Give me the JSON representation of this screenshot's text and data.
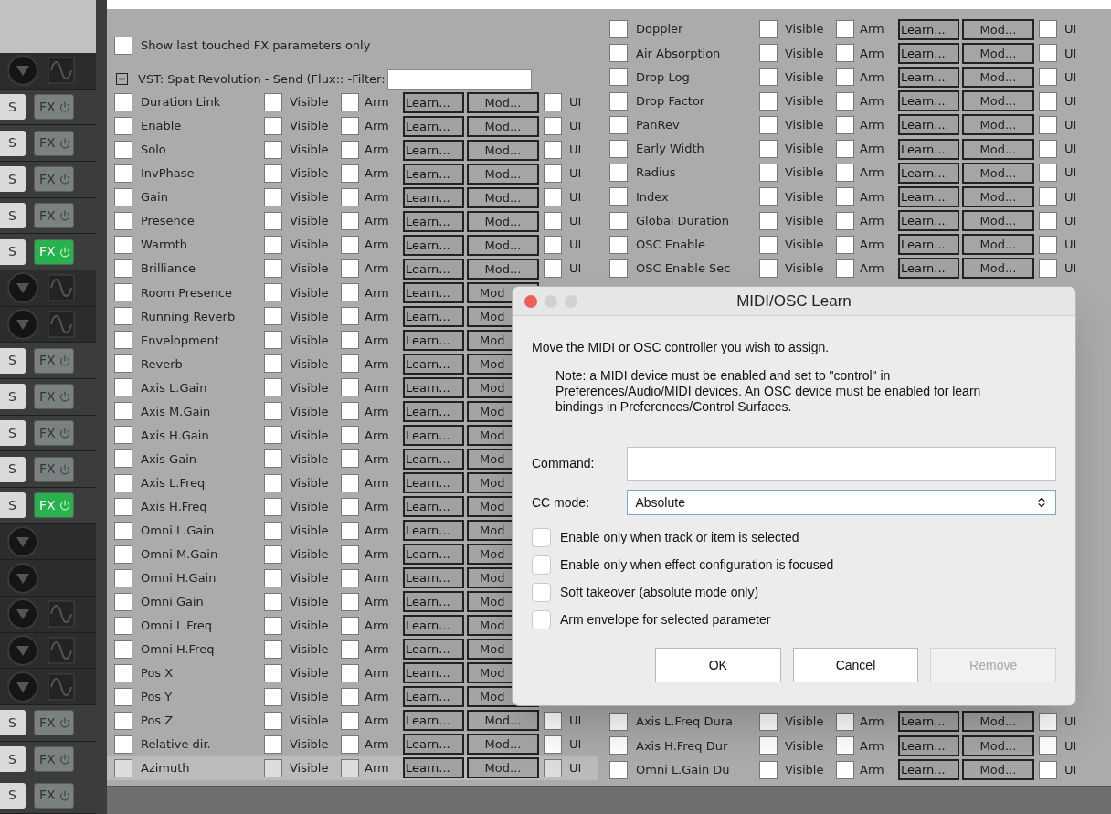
{
  "tracks": [
    {
      "kind": "knobs",
      "wave": true
    },
    {
      "kind": "fx",
      "solo": "S",
      "fx": "FX",
      "on": false
    },
    {
      "kind": "fx",
      "solo": "S",
      "fx": "FX",
      "on": false
    },
    {
      "kind": "fx",
      "solo": "S",
      "fx": "FX",
      "on": false
    },
    {
      "kind": "fx",
      "solo": "S",
      "fx": "FX",
      "on": false
    },
    {
      "kind": "fx",
      "solo": "S",
      "fx": "FX",
      "on": true
    },
    {
      "kind": "knobs",
      "wave": true
    },
    {
      "kind": "knobs",
      "wave": true
    },
    {
      "kind": "fx",
      "solo": "S",
      "fx": "FX",
      "on": false
    },
    {
      "kind": "fx",
      "solo": "S",
      "fx": "FX",
      "on": false
    },
    {
      "kind": "fx",
      "solo": "S",
      "fx": "FX",
      "on": false
    },
    {
      "kind": "fx",
      "solo": "S",
      "fx": "FX",
      "on": false
    },
    {
      "kind": "fx",
      "solo": "S",
      "fx": "FX",
      "on": true
    },
    {
      "kind": "knobs",
      "wave": false
    },
    {
      "kind": "knobs",
      "wave": false
    },
    {
      "kind": "knobs",
      "wave": true
    },
    {
      "kind": "knobs",
      "wave": true
    },
    {
      "kind": "knobs",
      "wave": true
    },
    {
      "kind": "fx",
      "solo": "S",
      "fx": "FX",
      "on": false
    },
    {
      "kind": "fx",
      "solo": "S",
      "fx": "FX",
      "on": false
    },
    {
      "kind": "fx",
      "solo": "S",
      "fx": "FX",
      "on": false
    }
  ],
  "panel": {
    "show_last_touched": {
      "label": "Show last touched FX parameters only",
      "checked": false
    },
    "plugin": {
      "title": "VST: Spat Revolution - Send (Flux:: -Filter:",
      "expanded": true
    }
  },
  "left_params": [
    {
      "name": "Duration Link",
      "checked": false,
      "visible": false,
      "arm": false,
      "ui": false,
      "selected": false,
      "visible_label": "Visible",
      "arm_label": "Arm",
      "learn": "Learn...",
      "mod": "Mod...",
      "ui_label": "UI"
    },
    {
      "name": "Enable",
      "checked": false,
      "visible": false,
      "arm": false,
      "ui": false,
      "selected": false,
      "visible_label": "Visible",
      "arm_label": "Arm",
      "learn": "Learn...",
      "mod": "Mod...",
      "ui_label": "UI"
    },
    {
      "name": "Solo",
      "checked": false,
      "visible": false,
      "arm": false,
      "ui": false,
      "selected": false,
      "visible_label": "Visible",
      "arm_label": "Arm",
      "learn": "Learn...",
      "mod": "Mod...",
      "ui_label": "UI"
    },
    {
      "name": "InvPhase",
      "checked": false,
      "visible": false,
      "arm": false,
      "ui": false,
      "selected": false,
      "visible_label": "Visible",
      "arm_label": "Arm",
      "learn": "Learn...",
      "mod": "Mod...",
      "ui_label": "UI"
    },
    {
      "name": "Gain",
      "checked": false,
      "visible": false,
      "arm": false,
      "ui": false,
      "selected": false,
      "visible_label": "Visible",
      "arm_label": "Arm",
      "learn": "Learn...",
      "mod": "Mod...",
      "ui_label": "UI"
    },
    {
      "name": "Presence",
      "checked": false,
      "visible": false,
      "arm": false,
      "ui": false,
      "selected": false,
      "visible_label": "Visible",
      "arm_label": "Arm",
      "learn": "Learn...",
      "mod": "Mod...",
      "ui_label": "UI"
    },
    {
      "name": "Warmth",
      "checked": false,
      "visible": false,
      "arm": false,
      "ui": false,
      "selected": false,
      "visible_label": "Visible",
      "arm_label": "Arm",
      "learn": "Learn...",
      "mod": "Mod...",
      "ui_label": "UI"
    },
    {
      "name": "Brilliance",
      "checked": false,
      "visible": false,
      "arm": false,
      "ui": false,
      "selected": false,
      "visible_label": "Visible",
      "arm_label": "Arm",
      "learn": "Learn...",
      "mod": "Mod...",
      "ui_label": "UI"
    },
    {
      "name": "Room Presence",
      "checked": false,
      "visible": false,
      "arm": false,
      "selected": false,
      "visible_label": "Visible",
      "arm_label": "Arm",
      "learn": "Learn...",
      "mod": "Mod"
    },
    {
      "name": "Running Reverb",
      "checked": false,
      "visible": false,
      "arm": false,
      "selected": false,
      "visible_label": "Visible",
      "arm_label": "Arm",
      "learn": "Learn...",
      "mod": "Mod"
    },
    {
      "name": "Envelopment",
      "checked": false,
      "visible": false,
      "arm": false,
      "selected": false,
      "visible_label": "Visible",
      "arm_label": "Arm",
      "learn": "Learn...",
      "mod": "Mod"
    },
    {
      "name": "Reverb",
      "checked": false,
      "visible": false,
      "arm": false,
      "selected": false,
      "visible_label": "Visible",
      "arm_label": "Arm",
      "learn": "Learn...",
      "mod": "Mod"
    },
    {
      "name": "Axis L.Gain",
      "checked": false,
      "visible": false,
      "arm": false,
      "selected": false,
      "visible_label": "Visible",
      "arm_label": "Arm",
      "learn": "Learn...",
      "mod": "Mod"
    },
    {
      "name": "Axis M.Gain",
      "checked": false,
      "visible": false,
      "arm": false,
      "selected": false,
      "visible_label": "Visible",
      "arm_label": "Arm",
      "learn": "Learn...",
      "mod": "Mod"
    },
    {
      "name": "Axis H.Gain",
      "checked": false,
      "visible": false,
      "arm": false,
      "selected": false,
      "visible_label": "Visible",
      "arm_label": "Arm",
      "learn": "Learn...",
      "mod": "Mod"
    },
    {
      "name": "Axis Gain",
      "checked": false,
      "visible": false,
      "arm": false,
      "selected": false,
      "visible_label": "Visible",
      "arm_label": "Arm",
      "learn": "Learn...",
      "mod": "Mod"
    },
    {
      "name": "Axis L.Freq",
      "checked": false,
      "visible": false,
      "arm": false,
      "selected": false,
      "visible_label": "Visible",
      "arm_label": "Arm",
      "learn": "Learn...",
      "mod": "Mod"
    },
    {
      "name": "Axis H.Freq",
      "checked": false,
      "visible": false,
      "arm": false,
      "selected": false,
      "visible_label": "Visible",
      "arm_label": "Arm",
      "learn": "Learn...",
      "mod": "Mod"
    },
    {
      "name": "Omni L.Gain",
      "checked": false,
      "visible": false,
      "arm": false,
      "selected": false,
      "visible_label": "Visible",
      "arm_label": "Arm",
      "learn": "Learn...",
      "mod": "Mod"
    },
    {
      "name": "Omni M.Gain",
      "checked": false,
      "visible": false,
      "arm": false,
      "selected": false,
      "visible_label": "Visible",
      "arm_label": "Arm",
      "learn": "Learn...",
      "mod": "Mod"
    },
    {
      "name": "Omni H.Gain",
      "checked": false,
      "visible": false,
      "arm": false,
      "selected": false,
      "visible_label": "Visible",
      "arm_label": "Arm",
      "learn": "Learn...",
      "mod": "Mod"
    },
    {
      "name": "Omni Gain",
      "checked": false,
      "visible": false,
      "arm": false,
      "selected": false,
      "visible_label": "Visible",
      "arm_label": "Arm",
      "learn": "Learn...",
      "mod": "Mod"
    },
    {
      "name": "Omni L.Freq",
      "checked": false,
      "visible": false,
      "arm": false,
      "selected": false,
      "visible_label": "Visible",
      "arm_label": "Arm",
      "learn": "Learn...",
      "mod": "Mod"
    },
    {
      "name": "Omni H.Freq",
      "checked": false,
      "visible": false,
      "arm": false,
      "selected": false,
      "visible_label": "Visible",
      "arm_label": "Arm",
      "learn": "Learn...",
      "mod": "Mod"
    },
    {
      "name": "Pos X",
      "checked": false,
      "visible": false,
      "arm": false,
      "selected": false,
      "visible_label": "Visible",
      "arm_label": "Arm",
      "learn": "Learn...",
      "mod": "Mod"
    },
    {
      "name": "Pos Y",
      "checked": false,
      "visible": false,
      "arm": false,
      "selected": false,
      "visible_label": "Visible",
      "arm_label": "Arm",
      "learn": "Learn...",
      "mod": "Mod"
    },
    {
      "name": "Pos Z",
      "checked": false,
      "visible": false,
      "arm": false,
      "ui": false,
      "selected": false,
      "visible_label": "Visible",
      "arm_label": "Arm",
      "learn": "Learn...",
      "mod": "Mod...",
      "ui_label": "UI"
    },
    {
      "name": "Relative dir.",
      "checked": false,
      "visible": false,
      "arm": false,
      "ui": false,
      "selected": false,
      "visible_label": "Visible",
      "arm_label": "Arm",
      "learn": "Learn...",
      "mod": "Mod...",
      "ui_label": "UI"
    },
    {
      "name": "Azimuth",
      "checked": false,
      "visible": false,
      "arm": false,
      "ui": false,
      "selected": true,
      "visible_label": "Visible",
      "arm_label": "Arm",
      "learn": "Learn...",
      "mod": "Mod...",
      "ui_label": "UI"
    }
  ],
  "right_params_top": [
    {
      "name": "Doppler",
      "checked": false,
      "visible": false,
      "arm": false,
      "ui": false,
      "selected": false,
      "visible_label": "Visible",
      "arm_label": "Arm",
      "learn": "Learn...",
      "mod": "Mod...",
      "ui_label": "UI"
    },
    {
      "name": "Air Absorption",
      "checked": false,
      "visible": false,
      "arm": false,
      "ui": false,
      "selected": false,
      "visible_label": "Visible",
      "arm_label": "Arm",
      "learn": "Learn...",
      "mod": "Mod...",
      "ui_label": "UI"
    },
    {
      "name": "Drop Log",
      "checked": false,
      "visible": false,
      "arm": false,
      "ui": false,
      "selected": false,
      "visible_label": "Visible",
      "arm_label": "Arm",
      "learn": "Learn...",
      "mod": "Mod...",
      "ui_label": "UI"
    },
    {
      "name": "Drop Factor",
      "checked": false,
      "visible": false,
      "arm": false,
      "ui": false,
      "selected": false,
      "visible_label": "Visible",
      "arm_label": "Arm",
      "learn": "Learn...",
      "mod": "Mod...",
      "ui_label": "UI"
    },
    {
      "name": "PanRev",
      "checked": false,
      "visible": false,
      "arm": false,
      "ui": false,
      "selected": false,
      "visible_label": "Visible",
      "arm_label": "Arm",
      "learn": "Learn...",
      "mod": "Mod...",
      "ui_label": "UI"
    },
    {
      "name": "Early Width",
      "checked": false,
      "visible": false,
      "arm": false,
      "ui": false,
      "selected": false,
      "visible_label": "Visible",
      "arm_label": "Arm",
      "learn": "Learn...",
      "mod": "Mod...",
      "ui_label": "UI"
    },
    {
      "name": "Radius",
      "checked": false,
      "visible": false,
      "arm": false,
      "ui": false,
      "selected": false,
      "visible_label": "Visible",
      "arm_label": "Arm",
      "learn": "Learn...",
      "mod": "Mod...",
      "ui_label": "UI"
    },
    {
      "name": "Index",
      "checked": false,
      "visible": false,
      "arm": false,
      "ui": false,
      "selected": false,
      "visible_label": "Visible",
      "arm_label": "Arm",
      "learn": "Learn...",
      "mod": "Mod...",
      "ui_label": "UI"
    },
    {
      "name": "Global Duration",
      "checked": false,
      "visible": false,
      "arm": false,
      "ui": false,
      "selected": false,
      "visible_label": "Visible",
      "arm_label": "Arm",
      "learn": "Learn...",
      "mod": "Mod...",
      "ui_label": "UI"
    },
    {
      "name": "OSC Enable",
      "checked": false,
      "visible": false,
      "arm": false,
      "ui": false,
      "selected": false,
      "visible_label": "Visible",
      "arm_label": "Arm",
      "learn": "Learn...",
      "mod": "Mod...",
      "ui_label": "UI"
    },
    {
      "name": "OSC Enable Sec",
      "checked": false,
      "visible": false,
      "arm": false,
      "ui": false,
      "selected": false,
      "visible_label": "Visible",
      "arm_label": "Arm",
      "learn": "Learn...",
      "mod": "Mod...",
      "ui_label": "UI"
    }
  ],
  "right_params_bottom": [
    {
      "name": "Axis L.Freq Dura",
      "checked": false,
      "visible": false,
      "arm": false,
      "ui": false,
      "selected": false,
      "visible_label": "Visible",
      "arm_label": "Arm",
      "learn": "Learn...",
      "mod": "Mod...",
      "ui_label": "UI"
    },
    {
      "name": "Axis H.Freq Dur",
      "checked": false,
      "visible": false,
      "arm": false,
      "ui": false,
      "selected": false,
      "visible_label": "Visible",
      "arm_label": "Arm",
      "learn": "Learn...",
      "mod": "Mod...",
      "ui_label": "UI"
    },
    {
      "name": "Omni L.Gain Du",
      "checked": false,
      "visible": false,
      "arm": false,
      "ui": false,
      "selected": false,
      "visible_label": "Visible",
      "arm_label": "Arm",
      "learn": "Learn...",
      "mod": "Mod...",
      "ui_label": "UI"
    }
  ],
  "dialog": {
    "title": "MIDI/OSC Learn",
    "message": "Move the MIDI or OSC controller you wish to assign.",
    "note": "Note: a MIDI device must be enabled and set to \"control\" in Preferences/Audio/MIDI devices. An OSC device must be enabled for learn bindings in Preferences/Control Surfaces.",
    "command": {
      "label": "Command:"
    },
    "cc_mode": {
      "label": "CC mode:",
      "value": "Absolute"
    },
    "options": [
      {
        "label": "Enable only when track or item is selected",
        "checked": false
      },
      {
        "label": "Enable only when effect configuration is focused",
        "checked": false
      },
      {
        "label": "Soft takeover (absolute mode only)",
        "checked": false
      },
      {
        "label": "Arm envelope for selected parameter",
        "checked": false
      }
    ],
    "buttons": [
      {
        "label": "OK",
        "disabled": false
      },
      {
        "label": "Cancel",
        "disabled": false
      },
      {
        "label": "Remove",
        "disabled": true
      }
    ]
  }
}
